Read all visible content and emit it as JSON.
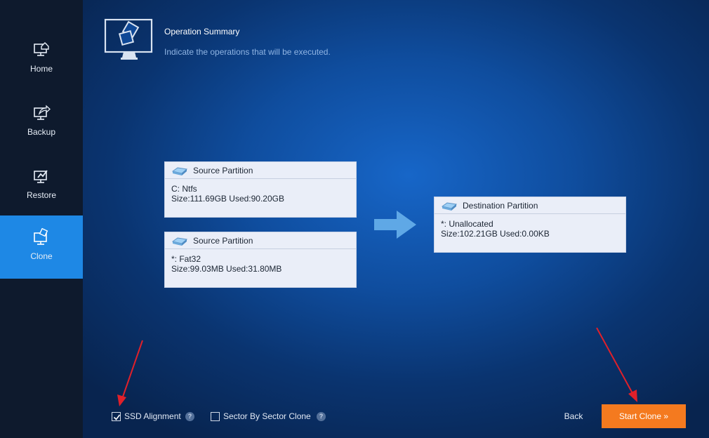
{
  "sidebar": {
    "items": [
      {
        "label": "Home",
        "icon": "home-icon"
      },
      {
        "label": "Backup",
        "icon": "backup-icon"
      },
      {
        "label": "Restore",
        "icon": "restore-icon"
      },
      {
        "label": "Clone",
        "icon": "clone-icon",
        "active": true
      }
    ]
  },
  "header": {
    "title": "Operation Summary",
    "subtitle": "Indicate the operations that will be executed."
  },
  "sources": [
    {
      "title": "Source Partition",
      "line1": "C: Ntfs",
      "line2": "Size:111.69GB  Used:90.20GB"
    },
    {
      "title": "Source Partition",
      "line1": "*: Fat32",
      "line2": "Size:99.03MB  Used:31.80MB"
    }
  ],
  "destination": {
    "title": "Destination Partition",
    "line1": "*: Unallocated",
    "line2": "Size:102.21GB  Used:0.00KB"
  },
  "options": {
    "ssd_alignment": {
      "label": "SSD Alignment",
      "checked": true
    },
    "sector_clone": {
      "label": "Sector By Sector Clone",
      "checked": false
    },
    "help_glyph": "?"
  },
  "buttons": {
    "back": "Back",
    "start": "Start Clone »"
  },
  "colors": {
    "accent": "#1e88e5",
    "start_button": "#f47a1f",
    "annotation_arrow": "#e0202a"
  }
}
